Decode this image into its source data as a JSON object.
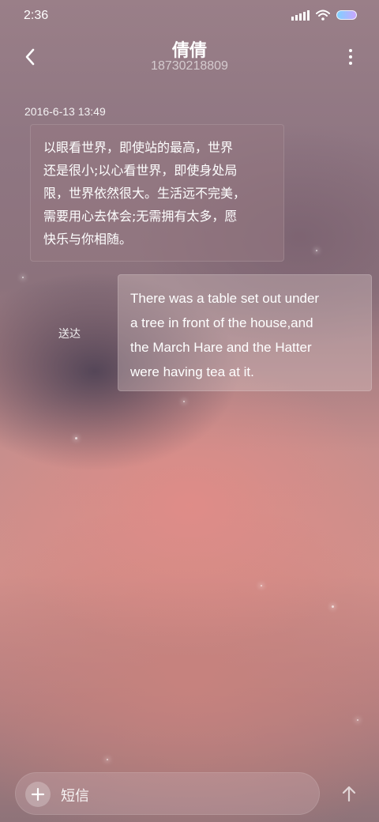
{
  "status_bar": {
    "time": "2:36",
    "icons": [
      "signal-icon",
      "wifi-icon",
      "battery-icon"
    ]
  },
  "header": {
    "back_icon": "chevron-left-icon",
    "contact_name": "倩倩",
    "contact_number": "18730218809",
    "more_icon": "more-vertical-icon"
  },
  "conversation": {
    "timestamp": "2016-6-13 13:49",
    "messages": [
      {
        "direction": "incoming",
        "lines": [
          "以眼看世界，即使站的最高，世界",
          "还是很小;以心看世界，即使身处局",
          "限，世界依然很大。生活远不完美，",
          "需要用心去体会;无需拥有太多，愿",
          "快乐与你相随。"
        ]
      },
      {
        "direction": "outgoing",
        "lines": [
          "There was a table set out under",
          "a tree in front of the house,and",
          "the March Hare and the Hatter",
          "were having tea at it."
        ],
        "status": "送达"
      }
    ]
  },
  "composer": {
    "add_icon": "plus-icon",
    "placeholder": "短信",
    "send_icon": "arrow-up-icon"
  }
}
